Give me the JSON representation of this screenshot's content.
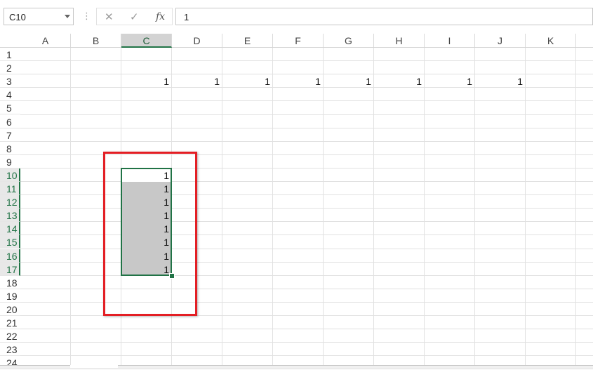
{
  "namebox": {
    "value": "C10"
  },
  "formula_bar": {
    "value": "1",
    "cancel_glyph": "✕",
    "enter_glyph": "✓",
    "fx_label": "fx",
    "dots": "⋮"
  },
  "columns": [
    "A",
    "B",
    "C",
    "D",
    "E",
    "F",
    "G",
    "H",
    "I",
    "J",
    "K"
  ],
  "selected_column": "C",
  "rows": [
    "1",
    "2",
    "3",
    "4",
    "5",
    "6",
    "7",
    "8",
    "9",
    "10",
    "11",
    "12",
    "13",
    "14",
    "15",
    "16",
    "17",
    "18",
    "19",
    "20",
    "21",
    "22",
    "23",
    "24"
  ],
  "selected_rows": [
    "10",
    "11",
    "12",
    "13",
    "14",
    "15",
    "16",
    "17"
  ],
  "cells": [
    {
      "ref": "C3",
      "value": "1"
    },
    {
      "ref": "D3",
      "value": "1"
    },
    {
      "ref": "E3",
      "value": "1"
    },
    {
      "ref": "F3",
      "value": "1"
    },
    {
      "ref": "G3",
      "value": "1"
    },
    {
      "ref": "H3",
      "value": "1"
    },
    {
      "ref": "I3",
      "value": "1"
    },
    {
      "ref": "J3",
      "value": "1"
    },
    {
      "ref": "C10",
      "value": "1"
    },
    {
      "ref": "C11",
      "value": "1"
    },
    {
      "ref": "C12",
      "value": "1"
    },
    {
      "ref": "C13",
      "value": "1"
    },
    {
      "ref": "C14",
      "value": "1"
    },
    {
      "ref": "C15",
      "value": "1"
    },
    {
      "ref": "C16",
      "value": "1"
    },
    {
      "ref": "C17",
      "value": "1"
    }
  ],
  "selection": {
    "range": "C10:C17",
    "active": "C10"
  },
  "colors": {
    "accent": "#217346",
    "highlight_box": "#e31e24",
    "selection_fill": "#c8c8c8"
  }
}
